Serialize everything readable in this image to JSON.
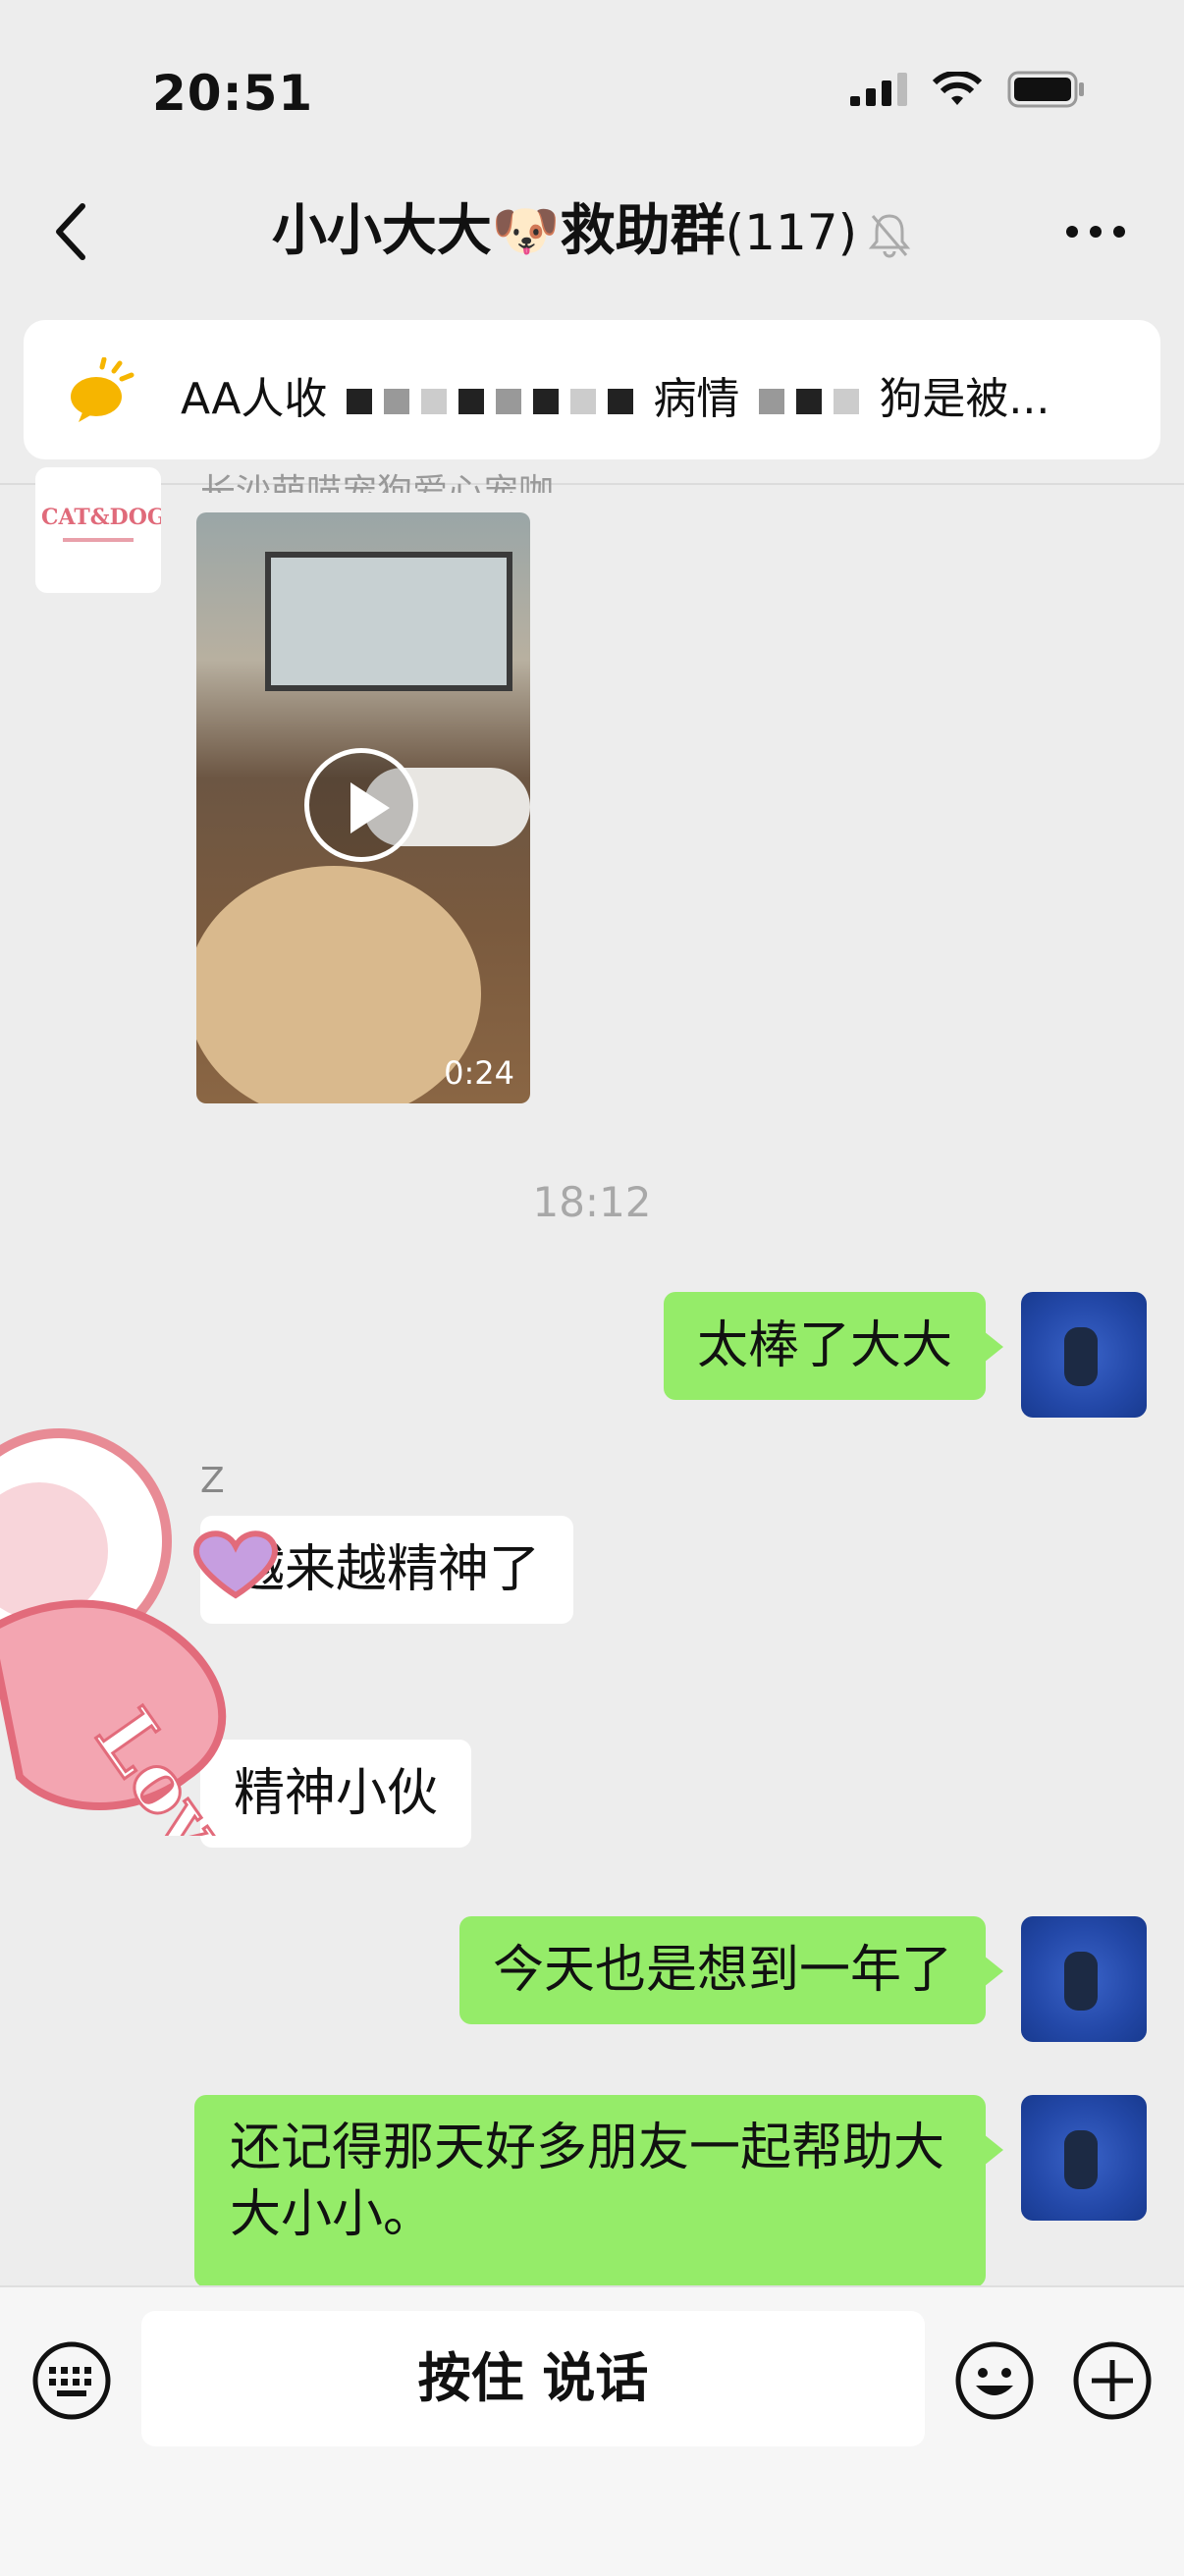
{
  "status": {
    "time": "20:51"
  },
  "header": {
    "title_main": "小小大大🐶救助群",
    "member_count": "(117)"
  },
  "notice": {
    "text_start": "AA人收",
    "text_mid": "病情",
    "text_end": "狗是被..."
  },
  "messages": {
    "top_sender": "长沙萌喵宠狗爱心宠咖",
    "avatar_logo": "CAT&DOG",
    "video_duration": "0:24",
    "timestamp": "18:12",
    "msg1": "太棒了大大",
    "sender_z": "Z",
    "msg2": "越来越精神了",
    "msg3": "精神小伙",
    "msg4": "今天也是想到一年了",
    "msg5": "还记得那天好多朋友一起帮助大大小小。"
  },
  "sticker": {
    "text": "Love"
  },
  "input": {
    "talk_label": "按住 说话"
  }
}
